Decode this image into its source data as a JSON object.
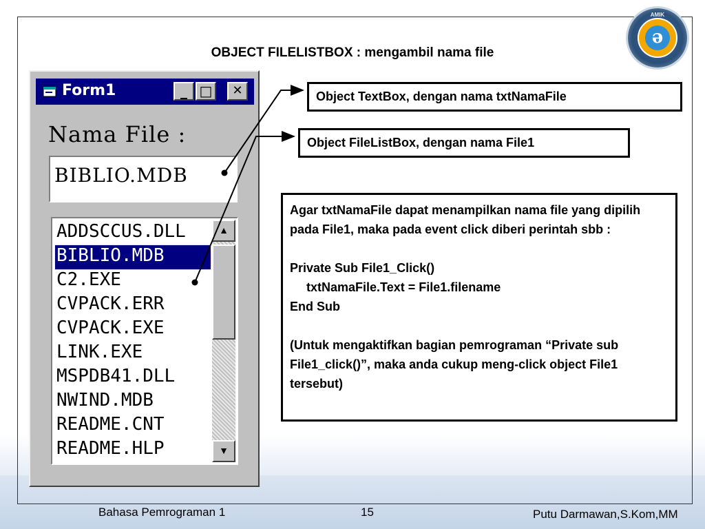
{
  "slide": {
    "title": "OBJECT FILELISTBOX : mengambil nama file",
    "logo_text": "AMIK"
  },
  "form": {
    "window_title": "Form1",
    "icon": "form-window-icon",
    "minimize_glyph": "_",
    "maximize_glyph": "□",
    "close_glyph": "✕",
    "label": "Nama File :",
    "textbox_value": "BIBLIO.MDB",
    "file_list": [
      "ADDSCCUS.DLL",
      "BIBLIO.MDB",
      "C2.EXE",
      "CVPACK.ERR",
      "CVPACK.EXE",
      "LINK.EXE",
      "MSPDB41.DLL",
      "NWIND.MDB",
      "README.CNT",
      "README.HLP"
    ],
    "selected_index": 1,
    "scroll_up_glyph": "▲",
    "scroll_down_glyph": "▼"
  },
  "callouts": {
    "textbox": "Object TextBox, dengan nama txtNamaFile",
    "filelist": "Object FileListBox, dengan nama File1"
  },
  "description": {
    "intro": "Agar txtNamaFile dapat menampilkan nama file yang dipilih pada File1, maka pada event click diberi perintah sbb :",
    "code_line1": "Private Sub File1_Click()",
    "code_line2": "txtNamaFile.Text = File1.filename",
    "code_line3": "End Sub",
    "note": "(Untuk mengaktifkan bagian pemrograman “Private sub File1_click()”, maka anda cukup meng-click object File1 tersebut)"
  },
  "footer": {
    "left": "Bahasa Pemrograman 1",
    "page": "15",
    "right": "Putu Darmawan,S.Kom,MM"
  },
  "colors": {
    "titlebar": "#000080",
    "window_face": "#c0c0c0",
    "selection": "#000080"
  }
}
